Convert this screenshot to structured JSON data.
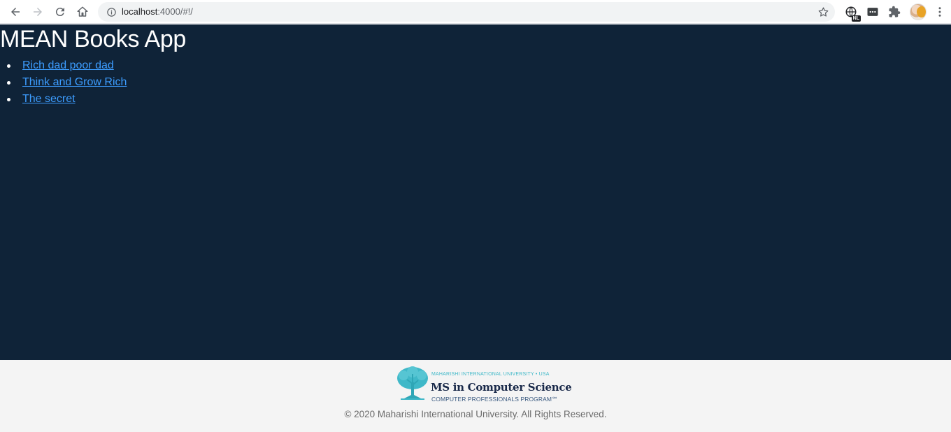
{
  "browser": {
    "url_host": "localhost",
    "url_path": ":4000/#!/",
    "icons": [
      "back-icon",
      "forward-icon",
      "reload-icon",
      "home-icon",
      "info-icon",
      "star-icon",
      "globe-extension-icon",
      "password-extension-icon",
      "puzzle-icon",
      "avatar",
      "kebab-menu-icon"
    ],
    "extension_badge": "NL"
  },
  "app": {
    "title": "MEAN Books App",
    "background": "#0f2338",
    "link_color": "#3d9dff",
    "books": [
      {
        "title": "Rich dad poor dad"
      },
      {
        "title": "Think and Grow Rich"
      },
      {
        "title": "The secret"
      }
    ]
  },
  "footer": {
    "logo": {
      "tagline": "MAHARISHI INTERNATIONAL UNIVERSITY • USA",
      "name": "MS in Computer Science",
      "program": "COMPUTER PROFESSIONALS PROGRAM℠"
    },
    "copyright": "© 2020 Maharishi International University. All Rights Reserved."
  }
}
